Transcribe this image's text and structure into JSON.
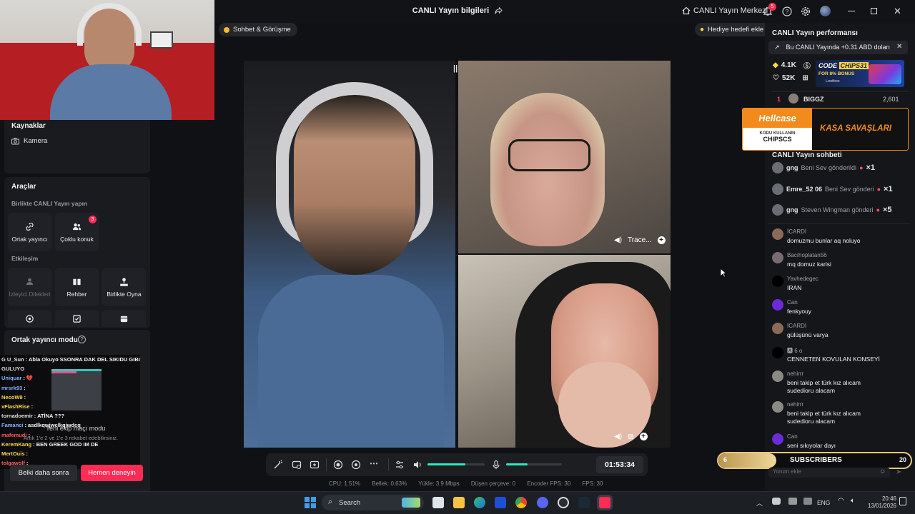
{
  "window": {
    "title": "CANLI Yayın bilgileri",
    "live_center_label": "CANLI Yayın Merkezi",
    "notif_count": "5"
  },
  "top_pills": {
    "chat_call": "Sohbet & Görüşme",
    "gift_goal": "Hediye hedefi ekle"
  },
  "left_panel": {
    "sources_title": "Kaynaklar",
    "camera_label": "Kamera",
    "tools_title": "Araçlar",
    "live_together": "Birlikte CANLI Yayın yapın",
    "cohost": "Ortak yayıncı",
    "multi_guest": "Çoklu konuk",
    "multi_guest_badge": "3",
    "interaction": "Etkileşim",
    "viewer_requests": "İzleyici Dilekleri",
    "guide": "Rehber",
    "play_together": "Birlikte Oyna",
    "cohost_mode": "Ortak yayıncı modu",
    "team_match": "Yeni ekip maçı modu",
    "team_match_sub": "Artık 1'e 2 ve 1'e 3 rekabet edebilirsiniz.",
    "later_button": "Belki daha sonra",
    "try_now_button": "Hemen deneyin"
  },
  "overlay_chat": [
    {
      "user": "G U_Sun",
      "msg": ": Abla Okuyo SSONRA DAK DEL SIKIDU GIBI",
      "color": "#e0e0e0"
    },
    {
      "user": "GULUYO",
      "msg": "",
      "color": "#e0e0e0"
    },
    {
      "user": "Uniquar",
      "msg": ": 💔",
      "color": "#7fb3ff"
    },
    {
      "user": "mrsrk93",
      "msg": ":",
      "color": "#7fb3ff"
    },
    {
      "user": "NecoW9",
      "msg": ":",
      "color": "#ffd84d"
    },
    {
      "user": "xFlashRise",
      "msg": ":",
      "color": "#ffd84d"
    },
    {
      "user": "tornadoemir",
      "msg": ": ATİNA ???",
      "color": "#e0e0e0"
    },
    {
      "user": "Famanci",
      "msg": ": asdlkqwjwclkqjwdcq",
      "color": "#7fb3ff"
    },
    {
      "user": "mafemudi",
      "msg": ":",
      "color": "#ff5a5a"
    },
    {
      "user": "KeremKang",
      "msg": ": BEN GREEK GOD IM DE",
      "color": "#ffd84d"
    },
    {
      "user": "MertOuis",
      "msg": ":",
      "color": "#ffd84d"
    },
    {
      "user": "tolgawolf",
      "msg": ":",
      "color": "#ff5a5a"
    }
  ],
  "video": {
    "guest1_name": "Trace...",
    "duration": "01:53:34"
  },
  "stats": {
    "cpu": "CPU: 1.51%",
    "memory": "Bellek: 0.63%",
    "upload": "Yükle: 3.9 Mbps",
    "dropped": "Düşen çerçeve: 0",
    "encoder_fps": "Encoder FPS: 30",
    "fps": "FPS: 30"
  },
  "right_panel": {
    "performance_title": "CANLI Yayın performansı",
    "earning_note": "Bu CANLI Yayında +0.31 ABD doları",
    "coins": "4.1K",
    "likes": "52K",
    "ad_code": "CODE",
    "ad_chips": "CHIPS31",
    "ad_bonus": "FOR 8% BONUS",
    "ad_brand": "Lootbox",
    "rank_num": "1",
    "rank_user": "BIGGZ",
    "rank_score": "2,601",
    "hellcase": "Hellcase",
    "hellcase_code_label": "KODU KULLANIN",
    "hellcase_code": "CHIPSCS",
    "hellcase_slogan": "KASA SAVAŞLARI",
    "chat_title": "CANLI Yayın sohbeti",
    "comment_placeholder": "Yorum ekle",
    "subscribers_label": "SUBSCRIBERS",
    "subscribers_left": "6",
    "subscribers_right": "20",
    "subscribers_progress": 0.3
  },
  "gifts": [
    {
      "user": "gng",
      "text": "Beni Sev gönderildi",
      "count": "×1"
    },
    {
      "user": "Emre_52 06",
      "text": "Beni Sev gönderi",
      "count": "×1"
    },
    {
      "user": "gng",
      "text": "Steven Wingman gönderi",
      "count": "×5"
    }
  ],
  "comments": [
    {
      "user": "İCARDİ",
      "text": "domuzmu bunlar aq noluyo",
      "color": "#8a6b5a"
    },
    {
      "user": "Bacıhoplatan56",
      "text": "mq domuz karisi",
      "color": "#7a6b70"
    },
    {
      "user": "Yavhedegec",
      "text": "IRAN",
      "color": "#000000"
    },
    {
      "user": "Can",
      "text": "fenkyouy",
      "color": "#6a2bd9"
    },
    {
      "user": "İCARDİ",
      "text": "gülüşünü varya",
      "color": "#8a6b5a"
    },
    {
      "user": "🅰 6 o",
      "text": "CENNETEN KOVULAN KONSEYİ",
      "color": "#000000"
    },
    {
      "user": "nehirrr",
      "text": "beni takip et türk kız alıcam sudedioru alacam",
      "color": "#8c8a85"
    },
    {
      "user": "nehirrr",
      "text": "beni takip et türk kız alıcam sudedioru alacam",
      "color": "#8c8a85"
    },
    {
      "user": "Can",
      "text": "seni sıkıyolar dayı",
      "color": "#6a2bd9"
    }
  ],
  "taskbar": {
    "search": "Search",
    "lang": "ENG",
    "time": "20:46",
    "date": "13/01/2026"
  }
}
